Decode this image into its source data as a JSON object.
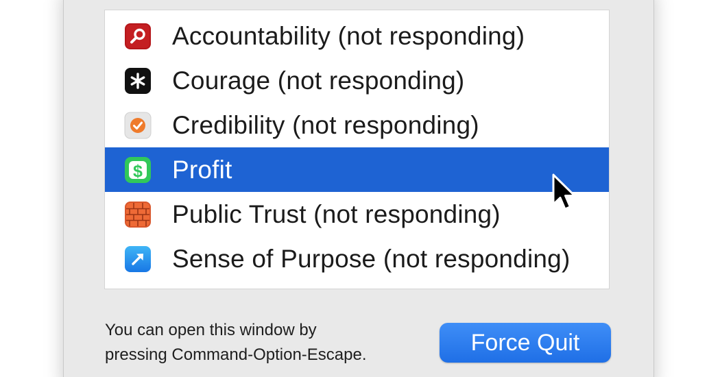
{
  "force_quit_dialog": {
    "apps": [
      {
        "name": "Accountability (not responding)",
        "icon": "accountability-app-icon",
        "selected": false
      },
      {
        "name": "Courage (not responding)",
        "icon": "courage-app-icon",
        "selected": false
      },
      {
        "name": "Credibility (not responding)",
        "icon": "credibility-app-icon",
        "selected": false
      },
      {
        "name": "Profit",
        "icon": "profit-app-icon",
        "selected": true
      },
      {
        "name": "Public Trust (not responding)",
        "icon": "public-trust-app-icon",
        "selected": false
      },
      {
        "name": "Sense of Purpose (not responding)",
        "icon": "sense-of-purpose-app-icon",
        "selected": false
      }
    ],
    "hint_line_1": "You can open this window by",
    "hint_line_2": "pressing Command-Option-Escape.",
    "force_quit_label": "Force Quit"
  },
  "colors": {
    "selection": "#1e63d3",
    "button": "#2a7cf0",
    "window_bg": "#e9e9e9"
  }
}
